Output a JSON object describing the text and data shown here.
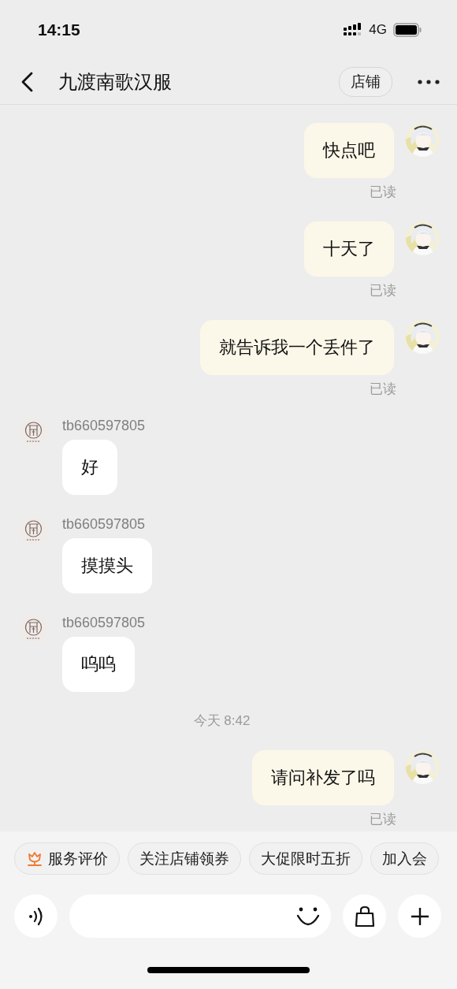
{
  "status_bar": {
    "time": "14:15",
    "network": "4G"
  },
  "header": {
    "title": "九渡南歌汉服",
    "shop_button": "店铺"
  },
  "messages": [
    {
      "kind": "out",
      "text": "快点吧",
      "receipt": "已读"
    },
    {
      "kind": "out",
      "text": "十天了",
      "receipt": "已读"
    },
    {
      "kind": "out",
      "text": "就告诉我一个丢件了",
      "receipt": "已读"
    },
    {
      "kind": "in",
      "sender": "tb660597805",
      "text": "好"
    },
    {
      "kind": "in",
      "sender": "tb660597805",
      "text": "摸摸头"
    },
    {
      "kind": "in",
      "sender": "tb660597805",
      "text": "呜呜"
    },
    {
      "kind": "time",
      "text": "今天 8:42"
    },
    {
      "kind": "out",
      "text": "请问补发了吗",
      "receipt": "已读"
    }
  ],
  "quick_actions": [
    {
      "label": "服务评价",
      "kind": "icon"
    },
    {
      "label": "关注店铺领券",
      "kind": "plain"
    },
    {
      "label": "大促限时五折",
      "kind": "plain"
    },
    {
      "label": "加入会",
      "kind": "plain"
    }
  ]
}
